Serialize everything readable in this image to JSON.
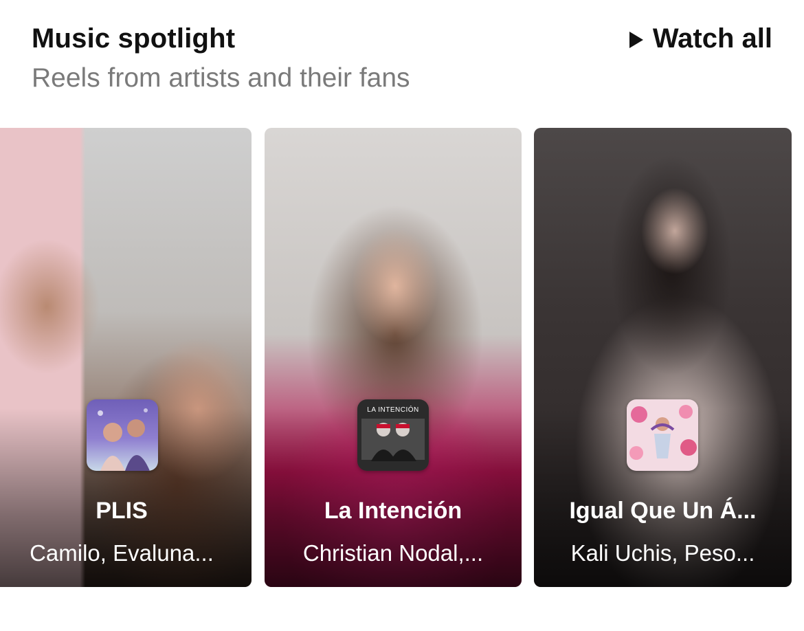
{
  "header": {
    "title": "Music spotlight",
    "subtitle": "Reels from artists and their fans",
    "watch_all_label": "Watch all"
  },
  "icons": {
    "play": "play-icon"
  },
  "cards": [
    {
      "song": "PLIS",
      "artist": "Camilo, Evaluna...",
      "cover_icon": "album-cover"
    },
    {
      "song": "La Intención",
      "artist": "Christian Nodal,...",
      "cover_text": "LA INTENCIÓN",
      "cover_icon": "album-cover"
    },
    {
      "song": "Igual Que Un Á...",
      "artist": "Kali Uchis, Peso...",
      "cover_icon": "album-cover"
    }
  ]
}
